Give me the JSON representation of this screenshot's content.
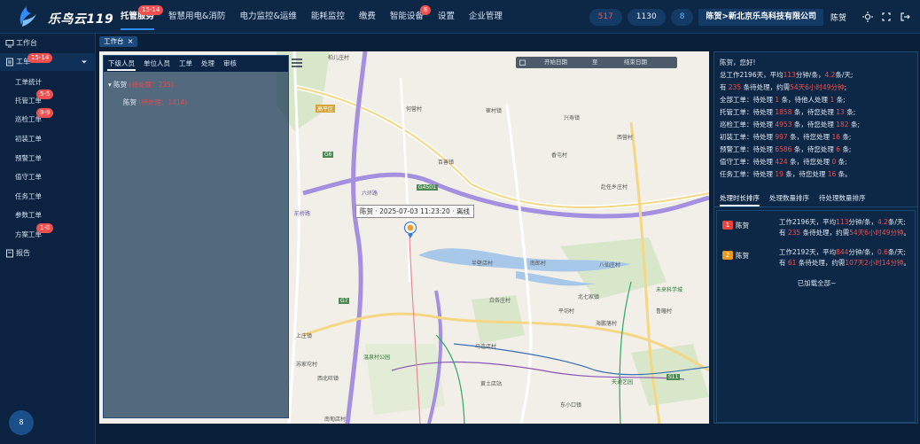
{
  "app": {
    "logo_text": "乐鸟云119"
  },
  "nav": [
    {
      "label": "托管服务",
      "badge": "15-14",
      "active": true
    },
    {
      "label": "智慧用电&消防",
      "badge": "",
      "active": false
    },
    {
      "label": "电力监控&运维",
      "badge": "",
      "active": false
    },
    {
      "label": "能耗监控",
      "badge": "",
      "active": false
    },
    {
      "label": "缴费",
      "badge": "",
      "active": false
    },
    {
      "label": "智能设备",
      "badge": "8",
      "active": false
    },
    {
      "label": "设置",
      "badge": "",
      "active": false
    },
    {
      "label": "企业管理",
      "badge": "",
      "active": false
    }
  ],
  "header": {
    "count_red": "517",
    "count_white": "1130",
    "count_blue": "8",
    "company": "陈贺>新北京乐鸟科技有限公司",
    "user": "陈贺"
  },
  "sidebar": {
    "workbench": "工作台",
    "workorder": "工单",
    "workorder_badge": "15-14",
    "subs": [
      {
        "label": "工单统计",
        "badge": ""
      },
      {
        "label": "托管工单",
        "badge": "5-5"
      },
      {
        "label": "巡检工单",
        "badge": "9-9"
      },
      {
        "label": "初装工单",
        "badge": ""
      },
      {
        "label": "预警工单",
        "badge": ""
      },
      {
        "label": "值守工单",
        "badge": ""
      },
      {
        "label": "任务工单",
        "badge": ""
      },
      {
        "label": "参数工单",
        "badge": ""
      },
      {
        "label": "方案工单",
        "badge": "1-0"
      }
    ],
    "report": "报告",
    "avatar": "8"
  },
  "tabbar": {
    "tab": "工作台"
  },
  "map": {
    "date_start": "开始日期",
    "date_sep": "至",
    "date_end": "结束日期",
    "popup": "陈贺 · 2025-07-03 11:23:20 · 离线",
    "labels": [
      "柏儿庄村",
      "高平区",
      "何营村",
      "崔村镇",
      "兴寿镇",
      "百善镇",
      "香屯村",
      "西营村",
      "赴任乡庄村",
      "六环路",
      "前桥路",
      "半壁店村",
      "南郎村",
      "八仙庄村",
      "北七家镇",
      "白各庄村",
      "平坊村",
      "海鹏落村",
      "鲁疃村",
      "上庄镇",
      "马连店村",
      "未来科学城",
      "温泉村公园",
      "苏家坨村",
      "西北旺镇",
      "黄土店站",
      "东小口镇",
      "天通艺园",
      "南甸店村",
      "G6",
      "G7",
      "S11",
      "G4501"
    ]
  },
  "left_panel": {
    "tabs": [
      "下级人员",
      "单位人员",
      "工单",
      "处理",
      "审核"
    ],
    "group_name": "陈贺",
    "group_count": "(待处理：235)",
    "member_name": "陈贺",
    "member_count": "(待处理：1414)"
  },
  "right_panel": {
    "greeting": "陈贺，您好!",
    "summary": [
      "总工作2196天，平均",
      "113",
      "分钟/条，",
      "4.2",
      "条/天;"
    ],
    "pending": [
      "有 ",
      "235",
      " 条待处理，约需",
      "54天6小时49分钟",
      ";"
    ],
    "rows": [
      {
        "label": "全部工单：待处理",
        "a": "1",
        "mid": "条，待他人处理",
        "b": "1",
        "end": "条;"
      },
      {
        "label": "托管工单：待处理",
        "a": "1858",
        "mid": "条，待您处理",
        "b": "13",
        "end": "条;"
      },
      {
        "label": "巡检工单：待处理",
        "a": "4953",
        "mid": "条，待您处理",
        "b": "182",
        "end": "条;"
      },
      {
        "label": "初装工单：待处理",
        "a": "997",
        "mid": "条，待您处理",
        "b": "16",
        "end": "条;"
      },
      {
        "label": "预警工单：待处理",
        "a": "6586",
        "mid": "条，待您处理",
        "b": "6",
        "end": "条;"
      },
      {
        "label": "值守工单：待处理",
        "a": "424",
        "mid": "条，待您处理",
        "b": "0",
        "end": "条;"
      },
      {
        "label": "任务工单：待处理",
        "a": "19",
        "mid": "条，待您处理",
        "b": "16",
        "end": "条。"
      }
    ],
    "tabs": [
      "处理时长排序",
      "处理数量排序",
      "待处理数量排序"
    ],
    "ranks": [
      {
        "num": "1",
        "name": "陈贺",
        "l1": [
          "工作2196天，平均",
          "113",
          "分钟/条，",
          "4.2",
          "条/天;"
        ],
        "l2": [
          "有 ",
          "235",
          " 条待处理，约需",
          "54天6小时49分钟",
          "。"
        ],
        "color": "#e8443a"
      },
      {
        "num": "2",
        "name": "陈贺",
        "l1": [
          "工作2192天，平均",
          "844",
          "分钟/条，",
          "0.6",
          "条/天;"
        ],
        "l2": [
          "有 ",
          "61",
          " 条待处理，约需",
          "107天2小时14分钟",
          "。"
        ],
        "color": "#e89a1a"
      }
    ],
    "loaded": "已加载全部~"
  }
}
